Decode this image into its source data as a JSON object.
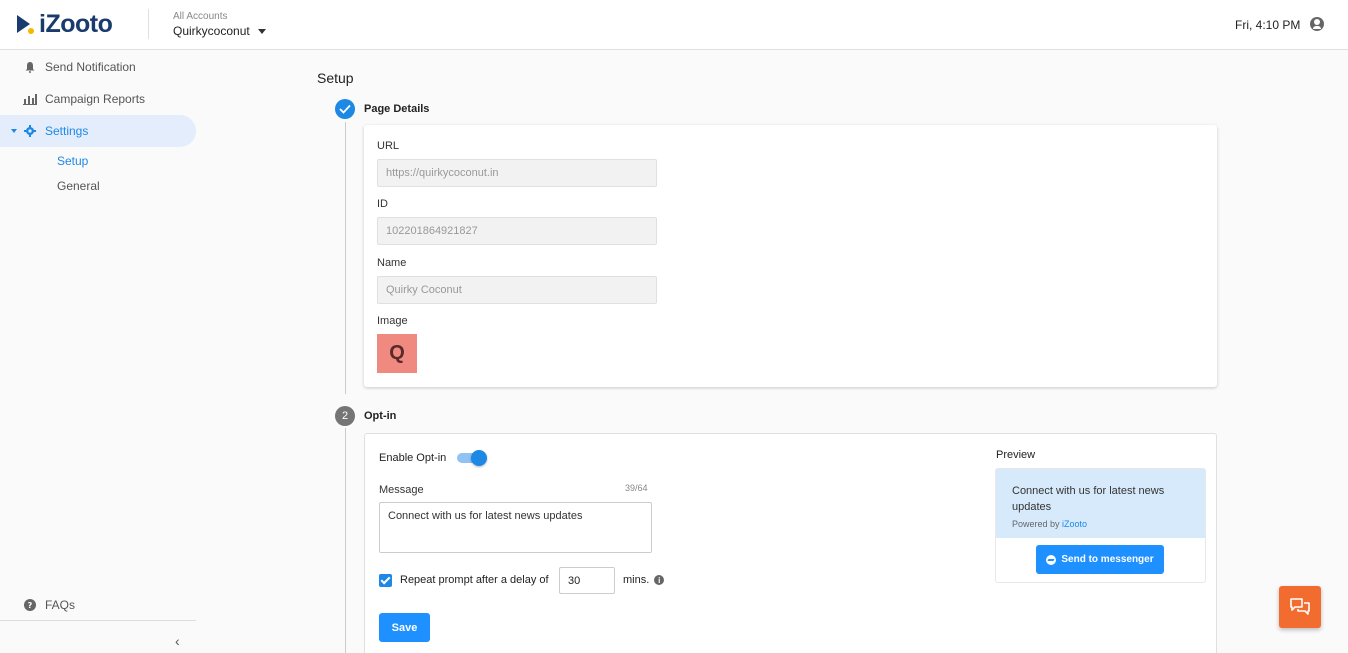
{
  "header": {
    "logo_text": "iZooto",
    "account_label": "All Accounts",
    "account_name": "Quirkycoconut",
    "time": "Fri, 4:10 PM"
  },
  "sidebar": {
    "items": [
      {
        "label": "Send Notification",
        "icon": "bell-icon"
      },
      {
        "label": "Campaign Reports",
        "icon": "bar-chart-icon"
      },
      {
        "label": "Settings",
        "icon": "gear-icon"
      }
    ],
    "sub_items": [
      {
        "label": "Setup",
        "active": true
      },
      {
        "label": "General",
        "active": false
      }
    ],
    "faqs_label": "FAQs",
    "collapse_glyph": "‹"
  },
  "main": {
    "title": "Setup",
    "step1": {
      "label": "Page Details",
      "url_label": "URL",
      "url_value": "https://quirkycoconut.in",
      "id_label": "ID",
      "id_value": "102201864921827",
      "name_label": "Name",
      "name_value": "Quirky Coconut",
      "image_label": "Image",
      "image_letter": "Q"
    },
    "step2": {
      "number": "2",
      "label": "Opt-in",
      "enable_label": "Enable Opt-in",
      "enabled": true,
      "message_label": "Message",
      "message_count": "39/64",
      "message_value": "Connect with us for latest news updates",
      "repeat_checked": true,
      "repeat_label": "Repeat prompt after a delay of",
      "delay_value": "30",
      "mins_label": "mins.",
      "save_label": "Save",
      "preview_label": "Preview",
      "preview_message": "Connect with us for latest news updates",
      "powered_by": "Powered by",
      "powered_brand": "iZooto",
      "messenger_button": "Send to messenger"
    }
  },
  "colors": {
    "accent": "#1e88e5",
    "brand_dark": "#1a3b6e",
    "chat_button": "#f26b2f",
    "page_image": "#f08a80"
  }
}
